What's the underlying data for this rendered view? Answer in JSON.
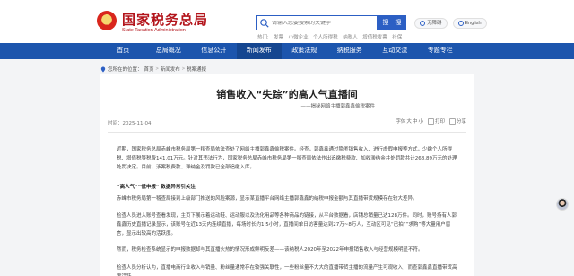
{
  "header": {
    "title": "国家税务总局",
    "subtitle": "State Taxation Administration",
    "search_placeholder": "请输入您要搜索的关键字",
    "search_button": "搜一搜",
    "hot_label": "热门:",
    "hot_terms": [
      "发票",
      "小微企业",
      "个人所得税",
      "纳税人",
      "增值税发票",
      "社保"
    ],
    "tools": [
      {
        "label": "无障碍",
        "icon": "accessibility-icon"
      },
      {
        "label": "English",
        "icon": "globe-icon"
      }
    ],
    "brand_color": "#b3141b"
  },
  "nav": {
    "items": [
      "首页",
      "总局概况",
      "信息公开",
      "新闻发布",
      "政策法规",
      "纳税服务",
      "互动交流",
      "专题专栏"
    ],
    "active_index": 3,
    "color": "#1c55ad"
  },
  "breadcrumb": {
    "prefix": "您所在的位置：",
    "items": [
      "首页",
      "新闻发布",
      "税案通报"
    ]
  },
  "article": {
    "title": "销售收入“失踪”的高人气直播间",
    "subtitle": "——揭秘网络主播郭鑫鑫偷税案件",
    "date": "时间：2025-11-04",
    "actions": [
      "字体",
      "大",
      "中",
      "小",
      "打印",
      "分享"
    ],
    "p1": "近期，国家税务总局赤峰市税务局第一稽查局依法查处了网络主播郭鑫鑫偷税案件。经查，郭鑫鑫通过隐匿销售收入、进行虚假申报等方式，少缴个人所得税、增值税等税费141.01万元。针对其违法行为，国家税务总局赤峰市税务局第一稽查局依法作出追缴税费款、加收滞纳金并处罚款共计268.89万元的处理处罚决定。目前，涉案税费款、滞纳金及罚款已全部追缴入库。",
    "heading1": "“高人气”“低申报”  数据异常引关注",
    "p2": "赤峰市税务局第一稽查局接到上级部门推送的风险案源，显示某直播平台网络主播郭鑫鑫的纳税申报金额与其直播带货规模存在较大差异。",
    "p3": "检查人员进入账号查看发现，主页下展示着运动鞋、运动服以及洗化用品等各种商品的链接，从平台数据看，店铺总销量已达128万件。同时，账号持有人郭鑫鑫历史直播记录显示，该账号在近13天内连续直播，每场时长约1.5小时，直播间单日访客量达到27万~8万人，互动区可见“已拍”“求购”等大量用户留言，显示出较高的活跃度。",
    "p4": "然而，税务检查系统显示的申报数据却与其直播火热的情况形成鲜明反差——该纳税人2020年至2022年申报销售收入与经营规模明显不符。",
    "p5": "检查人员分析认为，直播电商行业收入与销量、粉丝量通常存在较强关联性，一些粉丝量不大大的直播带货主播的流量产生可观收入，而查郭鑫鑫直播带货高度活跃..."
  }
}
